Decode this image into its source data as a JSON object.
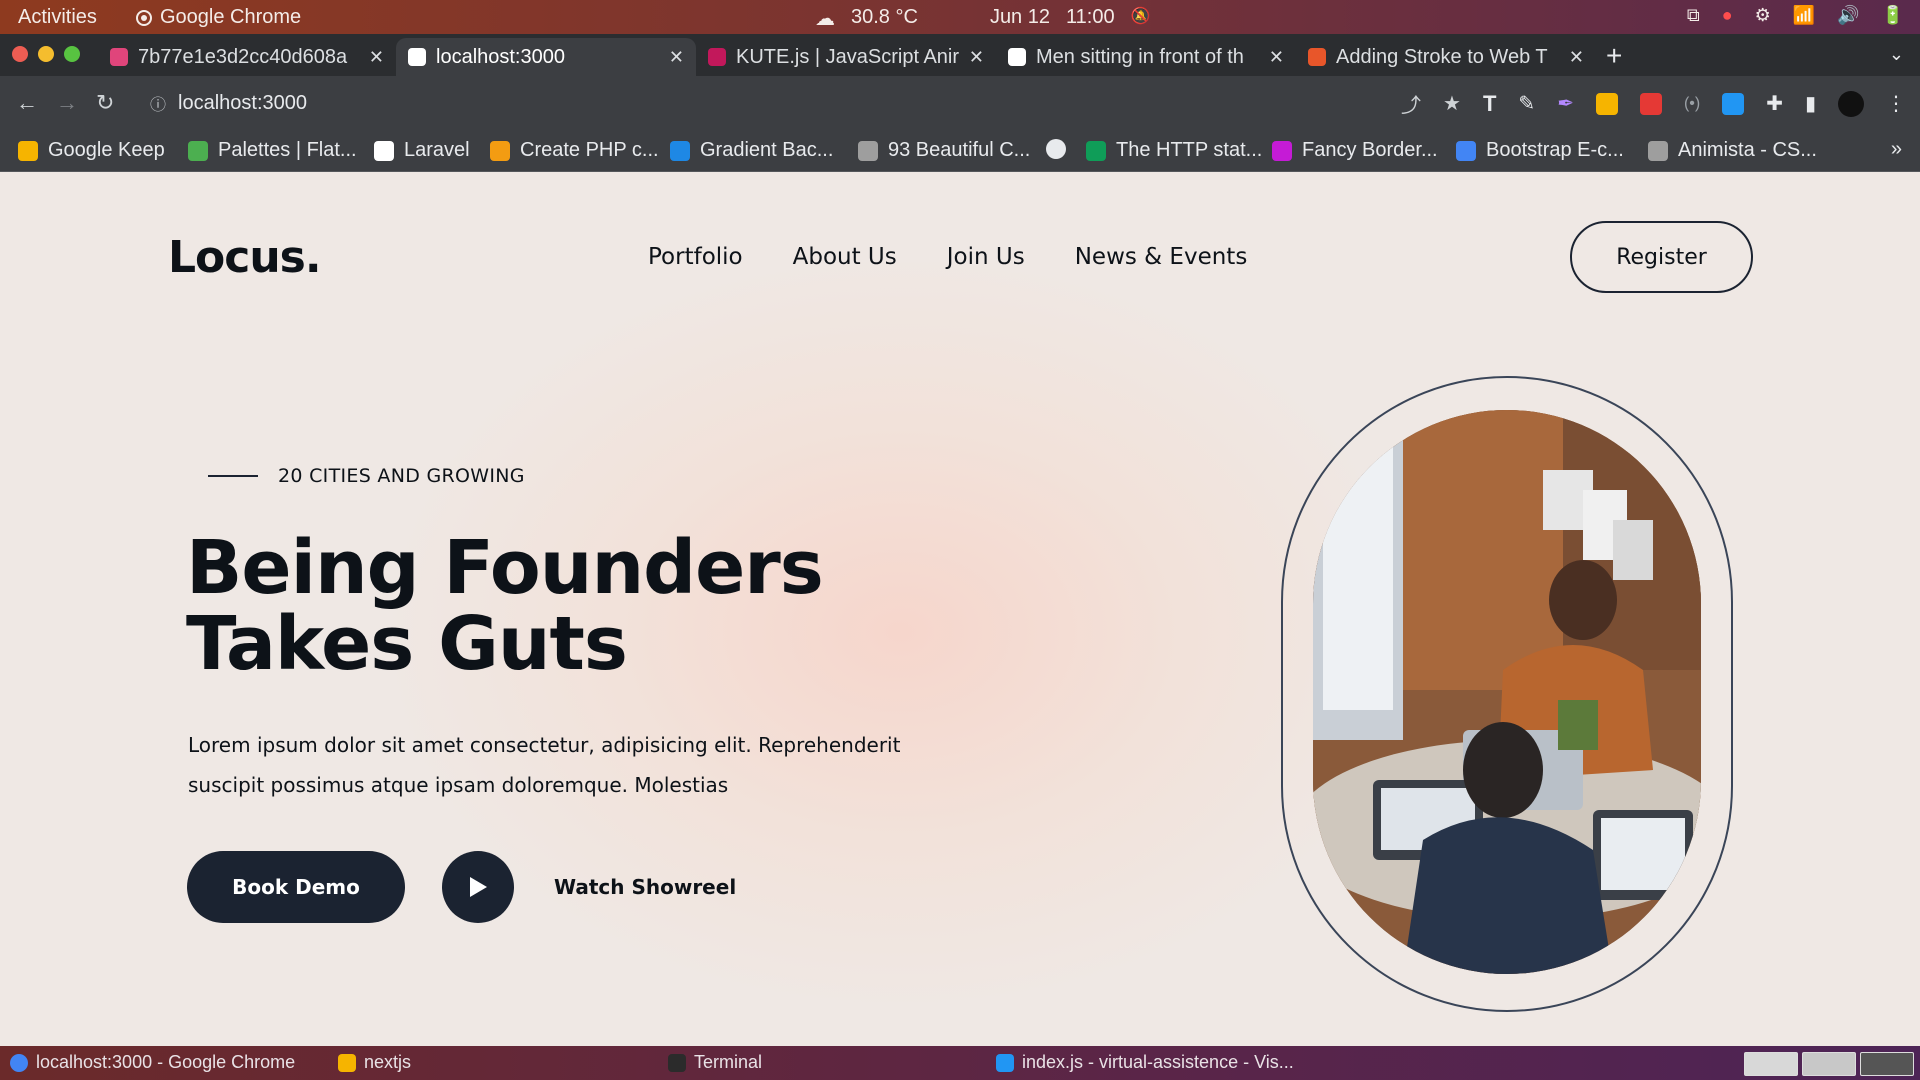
{
  "os_topbar": {
    "activities": "Activities",
    "app_name": "Google Chrome",
    "weather": "30.8 °C",
    "date": "Jun 12",
    "time": "11:00"
  },
  "browser": {
    "tabs": [
      {
        "title": "7b77e1e3d2cc40d608a",
        "active": false,
        "favicon_color": "#e0457b"
      },
      {
        "title": "localhost:3000",
        "active": true,
        "favicon_color": "#ffffff"
      },
      {
        "title": "KUTE.js | JavaScript Anir",
        "active": false,
        "favicon_color": "#c2185b"
      },
      {
        "title": "Men sitting in front of th",
        "active": false,
        "favicon_color": "#ffffff"
      },
      {
        "title": "Adding Stroke to Web T",
        "active": false,
        "favicon_color": "#e8562a"
      }
    ],
    "url": "localhost:3000",
    "bookmarks": [
      {
        "label": "Google Keep",
        "color": "#f6b400"
      },
      {
        "label": "Palettes | Flat...",
        "color": "#4caf50"
      },
      {
        "label": "Laravel",
        "color": "#ffffff"
      },
      {
        "label": "Create PHP c...",
        "color": "#f39c12"
      },
      {
        "label": "Gradient Bac...",
        "color": "#1e88e5"
      },
      {
        "label": "93 Beautiful C...",
        "color": "#9e9e9e"
      },
      {
        "label": "",
        "color": "#e8eaed"
      },
      {
        "label": "The HTTP stat...",
        "color": "#0f9d58"
      },
      {
        "label": "Fancy Border...",
        "color": "#c51bd6"
      },
      {
        "label": "Bootstrap E-c...",
        "color": "#4285f4"
      },
      {
        "label": "Animista - CS...",
        "color": "#9e9e9e"
      }
    ]
  },
  "site": {
    "logo": "Locus.",
    "nav": [
      "Portfolio",
      "About Us",
      "Join Us",
      "News & Events"
    ],
    "register": "Register",
    "tagline": "20 CITIES AND GROWING",
    "headline_line1": "Being Founders",
    "headline_line2": "Takes Guts",
    "description": "Lorem ipsum dolor sit amet consectetur, adipisicing elit. Reprehenderit suscipit possimus atque ipsam doloremque. Molestias",
    "book_demo": "Book Demo",
    "watch": "Watch Showreel",
    "accent": "#1b2331"
  },
  "taskbar": {
    "items": [
      "localhost:3000 - Google Chrome",
      "nextjs",
      "Terminal",
      "index.js - virtual-assistence - Vis..."
    ]
  }
}
